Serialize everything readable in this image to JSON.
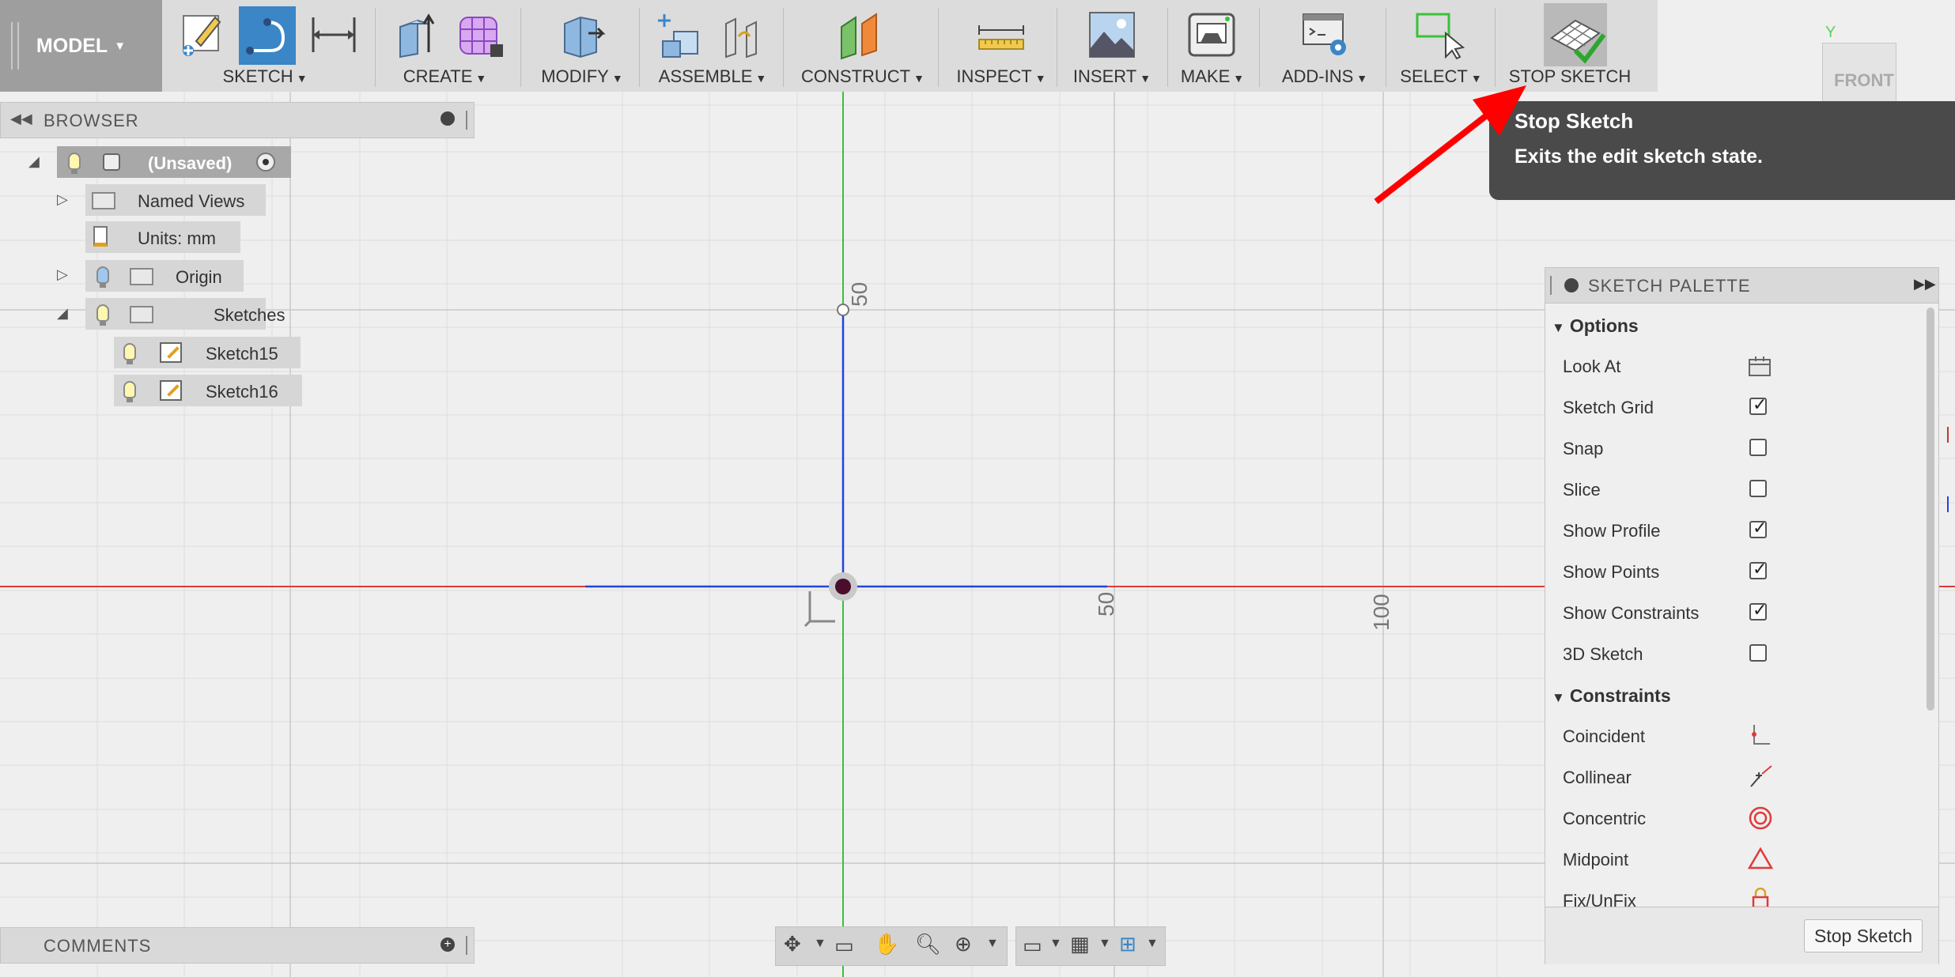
{
  "toolbar": {
    "workspace": "MODEL",
    "groups": [
      {
        "id": "sketch",
        "label": "SKETCH"
      },
      {
        "id": "create",
        "label": "CREATE"
      },
      {
        "id": "modify",
        "label": "MODIFY"
      },
      {
        "id": "assemble",
        "label": "ASSEMBLE"
      },
      {
        "id": "construct",
        "label": "CONSTRUCT"
      },
      {
        "id": "inspect",
        "label": "INSPECT"
      },
      {
        "id": "insert",
        "label": "INSERT"
      },
      {
        "id": "make",
        "label": "MAKE"
      },
      {
        "id": "addins",
        "label": "ADD-INS"
      },
      {
        "id": "select",
        "label": "SELECT"
      },
      {
        "id": "stopsketch",
        "label": "STOP SKETCH"
      }
    ]
  },
  "viewcube": {
    "face": "FRONT",
    "axis": "Y"
  },
  "browser": {
    "title": "BROWSER",
    "root": "(Unsaved)",
    "items": {
      "named_views": "Named Views",
      "units": "Units: mm",
      "origin": "Origin",
      "sketches": "Sketches",
      "sketch15": "Sketch15",
      "sketch16": "Sketch16"
    }
  },
  "tooltip": {
    "title": "Stop Sketch",
    "description": "Exits the edit sketch state."
  },
  "canvas": {
    "tick_labels": {
      "y50": "50",
      "x50": "50",
      "x100": "100"
    }
  },
  "palette": {
    "title": "SKETCH PALETTE",
    "options_heading": "Options",
    "options": [
      {
        "label": "Look At",
        "control": "look-at-icon"
      },
      {
        "label": "Sketch Grid",
        "checked": true
      },
      {
        "label": "Snap",
        "checked": false
      },
      {
        "label": "Slice",
        "checked": false
      },
      {
        "label": "Show Profile",
        "checked": true
      },
      {
        "label": "Show Points",
        "checked": true
      },
      {
        "label": "Show Constraints",
        "checked": true
      },
      {
        "label": "3D Sketch",
        "checked": false
      }
    ],
    "constraints_heading": "Constraints",
    "constraints": [
      {
        "label": "Coincident",
        "icon": "coincident-icon"
      },
      {
        "label": "Collinear",
        "icon": "collinear-icon"
      },
      {
        "label": "Concentric",
        "icon": "concentric-icon"
      },
      {
        "label": "Midpoint",
        "icon": "midpoint-icon"
      },
      {
        "label": "Fix/UnFix",
        "icon": "fix-icon"
      }
    ],
    "stop_button": "Stop Sketch"
  },
  "comments": {
    "title": "COMMENTS"
  },
  "colors": {
    "accent": "#3b86c6",
    "tooltip_bg": "#4a4a4a",
    "arrow": "#ff0000",
    "x_axis": "#e03a3a",
    "y_axis": "#3ac13a",
    "sketch_line": "#2244dd"
  }
}
